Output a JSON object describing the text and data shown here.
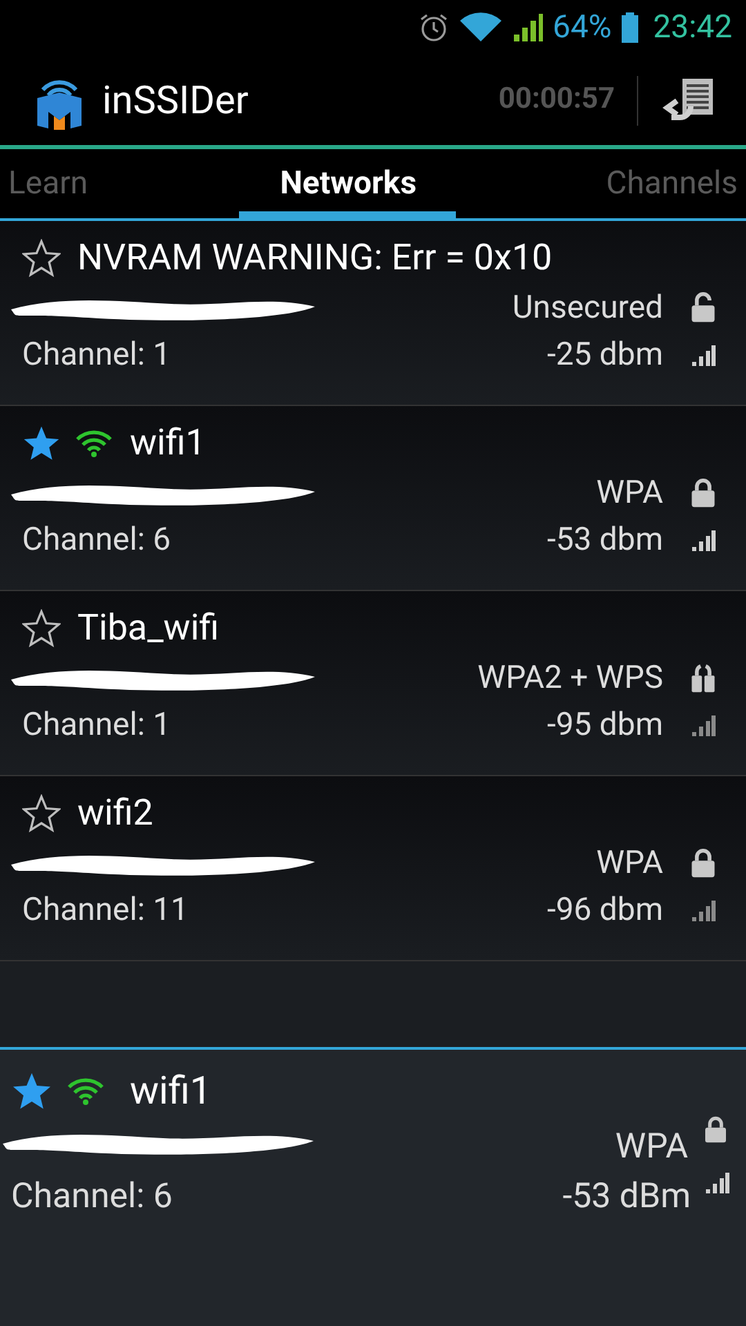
{
  "status_bar": {
    "battery": "64%",
    "time": "23:42"
  },
  "app_bar": {
    "title": "inSSIDer",
    "timer": "00:00:57"
  },
  "tabs": [
    {
      "label": "Learn",
      "selected": false
    },
    {
      "label": "Networks",
      "selected": true
    },
    {
      "label": "Channels",
      "selected": false
    }
  ],
  "networks": [
    {
      "name": "NVRAM WARNING: Err = 0x10",
      "starred": false,
      "connected": false,
      "security": "Unsecured",
      "secured": false,
      "wps": false,
      "channel": "Channel: 1",
      "signal": "-25 dbm",
      "strong": true
    },
    {
      "name": "wifi1",
      "starred": true,
      "connected": true,
      "security": "WPA",
      "secured": true,
      "wps": false,
      "channel": "Channel: 6",
      "signal": "-53 dbm",
      "strong": true
    },
    {
      "name": "Tiba_wifi",
      "starred": false,
      "connected": false,
      "security": "WPA2 + WPS",
      "secured": true,
      "wps": true,
      "channel": "Channel: 1",
      "signal": "-95 dbm",
      "strong": false
    },
    {
      "name": "wifi2",
      "starred": false,
      "connected": false,
      "security": "WPA",
      "secured": true,
      "wps": false,
      "channel": "Channel: 11",
      "signal": "-96 dbm",
      "strong": false
    }
  ],
  "detail": {
    "name": "wifi1",
    "starred": true,
    "connected": true,
    "security": "WPA",
    "channel": "Channel: 6",
    "signal": "-53 dBm"
  }
}
